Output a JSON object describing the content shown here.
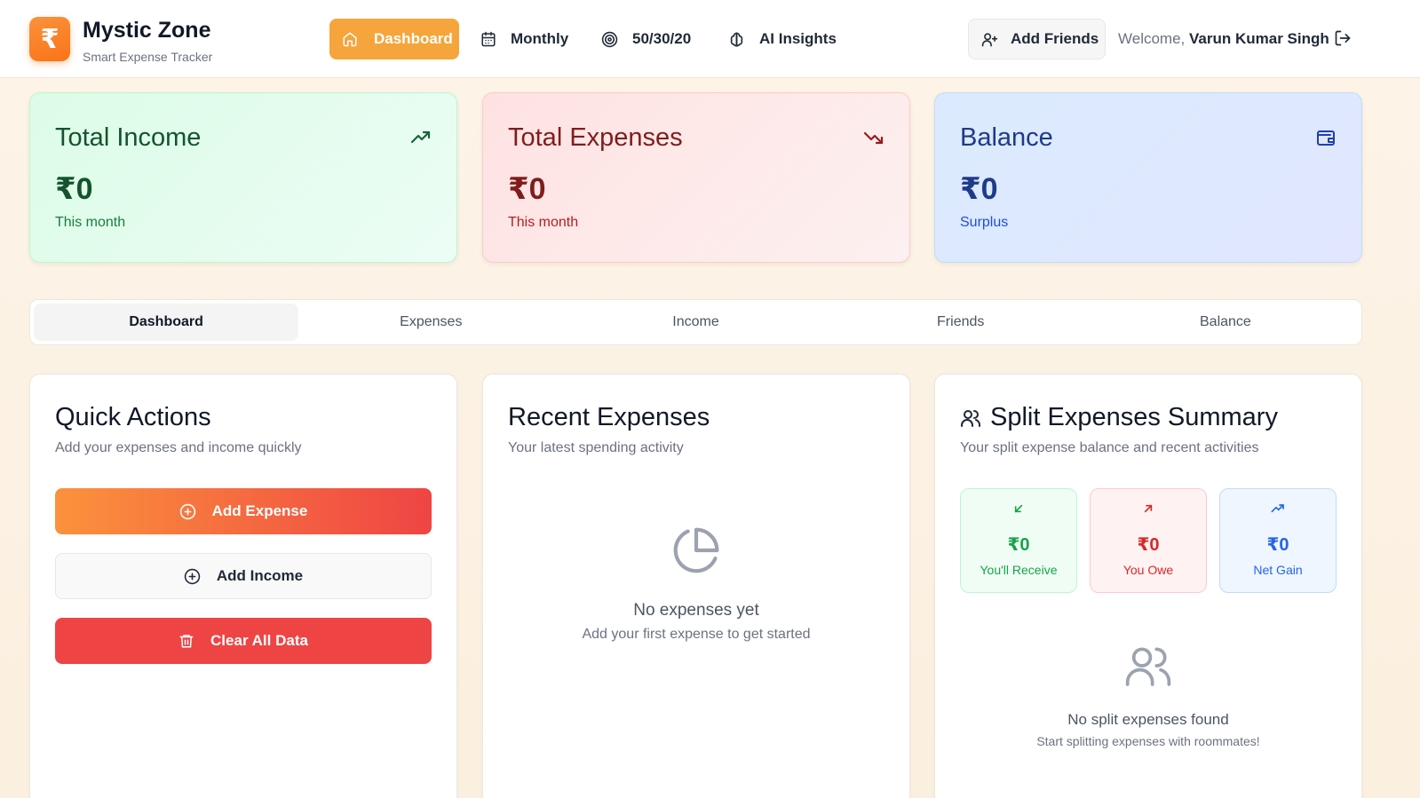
{
  "header": {
    "logo_symbol": "₹",
    "brand_title": "Mystic Zone",
    "brand_subtitle": "Smart Expense Tracker",
    "nav": {
      "dashboard": "Dashboard",
      "monthly": "Monthly",
      "budget_rule": "50/30/20",
      "ai_insights": "AI Insights"
    },
    "add_friends": "Add Friends",
    "welcome_prefix": "Welcome,",
    "user_name": "Varun Kumar Singh"
  },
  "stats": {
    "income": {
      "title": "Total Income",
      "value": "₹0",
      "sub": "This month"
    },
    "expenses": {
      "title": "Total Expenses",
      "value": "₹0",
      "sub": "This month"
    },
    "balance": {
      "title": "Balance",
      "value": "₹0",
      "sub": "Surplus"
    }
  },
  "tabs": [
    "Dashboard",
    "Expenses",
    "Income",
    "Friends",
    "Balance"
  ],
  "quick_actions": {
    "title": "Quick Actions",
    "subtitle": "Add your expenses and income quickly",
    "add_expense": "Add Expense",
    "add_income": "Add Income",
    "clear_all": "Clear All Data"
  },
  "recent_expenses": {
    "title": "Recent Expenses",
    "subtitle": "Your latest spending activity",
    "empty_title": "No expenses yet",
    "empty_sub": "Add your first expense to get started"
  },
  "split": {
    "title": "Split Expenses Summary",
    "subtitle": "Your split expense balance and recent activities",
    "receive": {
      "value": "₹0",
      "label": "You'll Receive"
    },
    "owe": {
      "value": "₹0",
      "label": "You Owe"
    },
    "net": {
      "value": "₹0",
      "label": "Net Gain"
    },
    "empty_title": "No split expenses found",
    "empty_sub": "Start splitting expenses with roommates!"
  },
  "colors": {
    "accent_orange": "#f5a53b",
    "income_green": "#16a34a",
    "expense_red": "#dc2626",
    "balance_blue": "#2563eb"
  }
}
